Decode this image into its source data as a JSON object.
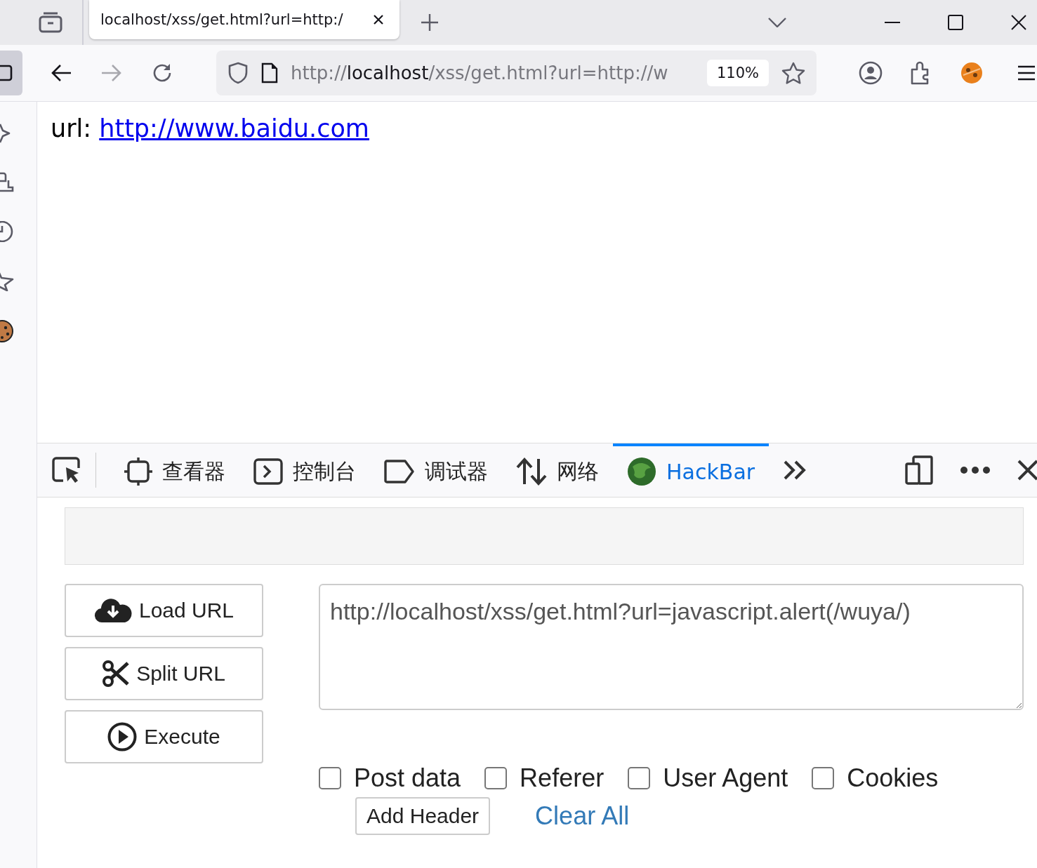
{
  "browser_tab": {
    "title": "localhost/xss/get.html?url=http:/",
    "selected": true
  },
  "address_bar": {
    "scheme": "http://",
    "host": "localhost",
    "path": "/xss/get.html?url=http://w",
    "zoom": "110%"
  },
  "page": {
    "label": "url:",
    "link": "http://www.baidu.com"
  },
  "devtools_tabs": [
    {
      "kind": "inspector",
      "label": "查看器",
      "selected": false
    },
    {
      "kind": "console",
      "label": "控制台",
      "selected": false
    },
    {
      "kind": "debugger",
      "label": "调试器",
      "selected": false
    },
    {
      "kind": "network",
      "label": "网络",
      "selected": false
    },
    {
      "kind": "hackbar",
      "label": "HackBar",
      "selected": true
    }
  ],
  "hackbar": {
    "buttons": [
      {
        "kind": "load",
        "label": "Load URL"
      },
      {
        "kind": "split",
        "label": "Split URL"
      },
      {
        "kind": "execute",
        "label": "Execute"
      }
    ],
    "url_value": "http://localhost/xss/get.html?url=javascript.alert(/wuya/)",
    "options": [
      {
        "label": "Post data",
        "checked": false
      },
      {
        "label": "Referer",
        "checked": false
      },
      {
        "label": "User Agent",
        "checked": false
      },
      {
        "label": "Cookies",
        "checked": false
      }
    ],
    "add_header": "Add Header",
    "clear_all": "Clear All"
  }
}
